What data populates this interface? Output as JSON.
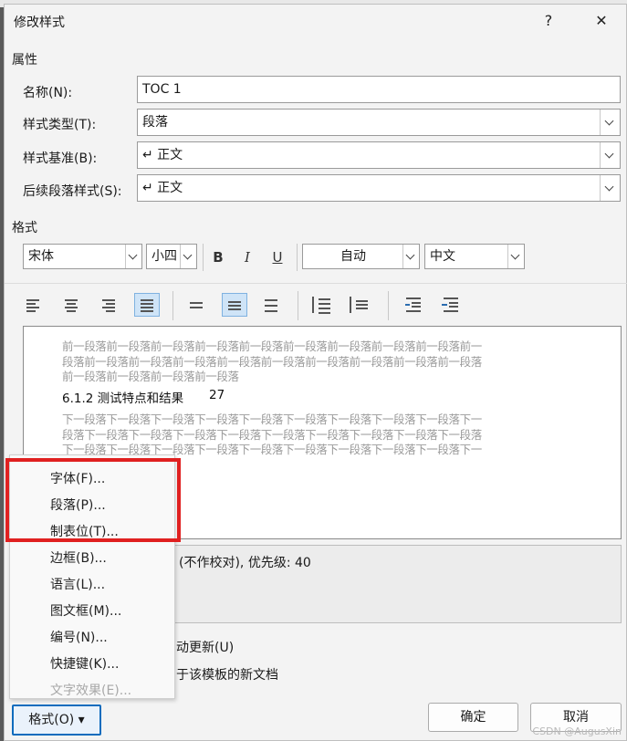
{
  "window": {
    "title": "修改样式",
    "help": "?",
    "close": "✕"
  },
  "properties": {
    "section_label": "属性",
    "name_label": "名称(N):",
    "name_value": "TOC 1",
    "type_label": "样式类型(T):",
    "type_value": "段落",
    "based_label": "样式基准(B):",
    "based_value": "↵ 正文",
    "next_label": "后续段落样式(S):",
    "next_value": "↵ 正文"
  },
  "format": {
    "section_label": "格式",
    "font": "宋体",
    "size": "小四",
    "bold": "B",
    "italic": "I",
    "underline": "U",
    "color": "自动",
    "language": "中文"
  },
  "preview": {
    "prev_text": [
      "前一段落前一段落前一段落前一段落前一段落前一段落前一段落前一段落前一段落前一",
      "段落前一段落前一段落前一段落前一段落前一段落前一段落前一段落前一段落前一段落",
      "前一段落前一段落前一段落前一段落"
    ],
    "sample": "6.1.2  测试特点和结果",
    "sample_page": "27",
    "next_text": [
      "下一段落下一段落下一段落下一段落下一段落下一段落下一段落下一段落下一段落下一",
      "段落下一段落下一段落下一段落下一段落下一段落下一段落下一段落下一段落下一段落",
      "下一段落下一段落下一段落下一段落下一段落下一段落下一段落下一段落下一段落下一"
    ]
  },
  "description": {
    "text": "(不作校对), 优先级: 40"
  },
  "options": {
    "auto_update": "动更新(U)",
    "template": "于该模板的新文档"
  },
  "menu": {
    "items": [
      {
        "label": "字体(F)...",
        "enabled": true
      },
      {
        "label": "段落(P)...",
        "enabled": true
      },
      {
        "label": "制表位(T)...",
        "enabled": true
      },
      {
        "label": "边框(B)...",
        "enabled": true
      },
      {
        "label": "语言(L)...",
        "enabled": true
      },
      {
        "label": "图文框(M)...",
        "enabled": true
      },
      {
        "label": "编号(N)...",
        "enabled": true
      },
      {
        "label": "快捷键(K)...",
        "enabled": true
      },
      {
        "label": "文字效果(E)...",
        "enabled": false
      }
    ]
  },
  "buttons": {
    "format": "格式(O) ▾",
    "ok": "确定",
    "cancel": "取消"
  },
  "watermark": "CSDN @AugusXin",
  "colors": {
    "highlight": "#e02020",
    "accent": "#0f6cbd",
    "active_tool": "#cfe4f7"
  }
}
